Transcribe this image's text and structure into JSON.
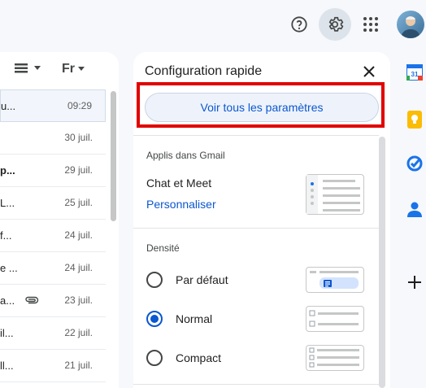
{
  "topbar": {
    "help_icon": "help-icon",
    "settings_icon": "gear-icon",
    "apps_icon": "apps-grid-icon",
    "avatar_icon": "avatar"
  },
  "mail_list": {
    "density_icon": "density-icon",
    "filter_label": "Fr",
    "rows": [
      {
        "snippet": "u...",
        "date": "09:29"
      },
      {
        "snippet": "",
        "date": "30 juil."
      },
      {
        "snippet": "p...",
        "date": "29 juil."
      },
      {
        "snippet": "L...",
        "date": "25 juil."
      },
      {
        "snippet": "f...",
        "date": "24 juil."
      },
      {
        "snippet": "e ...",
        "date": "24 juil."
      },
      {
        "snippet": "a...",
        "date": "23 juil."
      },
      {
        "snippet": "il...",
        "date": "22 juil."
      },
      {
        "snippet": "ll...",
        "date": "21 juil."
      }
    ]
  },
  "quick_settings": {
    "title": "Configuration rapide",
    "see_all_label": "Voir tous les paramètres",
    "apps_section": {
      "label": "Applis dans Gmail",
      "item_label": "Chat et Meet",
      "link_label": "Personnaliser"
    },
    "density_section": {
      "label": "Densité",
      "options": [
        {
          "label": "Par défaut",
          "selected": false
        },
        {
          "label": "Normal",
          "selected": true
        },
        {
          "label": "Compact",
          "selected": false
        }
      ]
    }
  },
  "colors": {
    "accent": "#0b57d0",
    "highlight_box": "#e10000",
    "background": "#f6f8fc"
  },
  "side_panel": {
    "icons": [
      "calendar-icon",
      "keep-icon",
      "tasks-icon",
      "contacts-icon",
      "add-icon"
    ],
    "calendar_day": "31"
  }
}
